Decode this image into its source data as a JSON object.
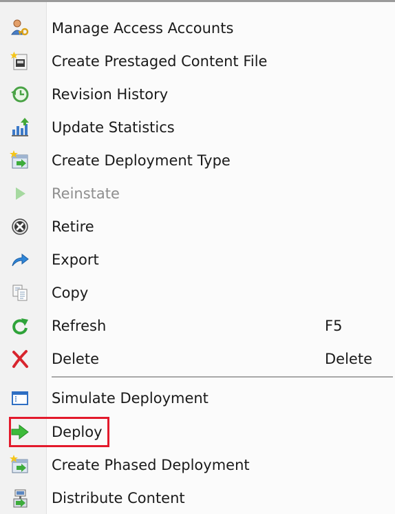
{
  "menu": {
    "items": [
      {
        "label": "Manage Access Accounts",
        "icon": "manage-access-accounts-icon",
        "shortcut": ""
      },
      {
        "label": "Create Prestaged Content File",
        "icon": "create-prestaged-content-file-icon",
        "shortcut": ""
      },
      {
        "label": "Revision History",
        "icon": "revision-history-icon",
        "shortcut": ""
      },
      {
        "label": "Update Statistics",
        "icon": "update-statistics-icon",
        "shortcut": ""
      },
      {
        "label": "Create Deployment Type",
        "icon": "create-deployment-type-icon",
        "shortcut": ""
      },
      {
        "label": "Reinstate",
        "icon": "reinstate-icon",
        "shortcut": "",
        "disabled": true
      },
      {
        "label": "Retire",
        "icon": "retire-icon",
        "shortcut": ""
      },
      {
        "label": "Export",
        "icon": "export-icon",
        "shortcut": ""
      },
      {
        "label": "Copy",
        "icon": "copy-icon",
        "shortcut": ""
      },
      {
        "label": "Refresh",
        "icon": "refresh-icon",
        "shortcut": "F5"
      },
      {
        "label": "Delete",
        "icon": "delete-icon",
        "shortcut": "Delete"
      },
      {
        "label": "Simulate Deployment",
        "icon": "simulate-deployment-icon",
        "shortcut": ""
      },
      {
        "label": "Deploy",
        "icon": "deploy-icon",
        "shortcut": "",
        "highlighted": true
      },
      {
        "label": "Create Phased Deployment",
        "icon": "create-phased-deployment-icon",
        "shortcut": ""
      },
      {
        "label": "Distribute Content",
        "icon": "distribute-content-icon",
        "shortcut": ""
      }
    ],
    "highlight_color": "#e3192b",
    "disabled_text_color": "#8e8e8e"
  }
}
